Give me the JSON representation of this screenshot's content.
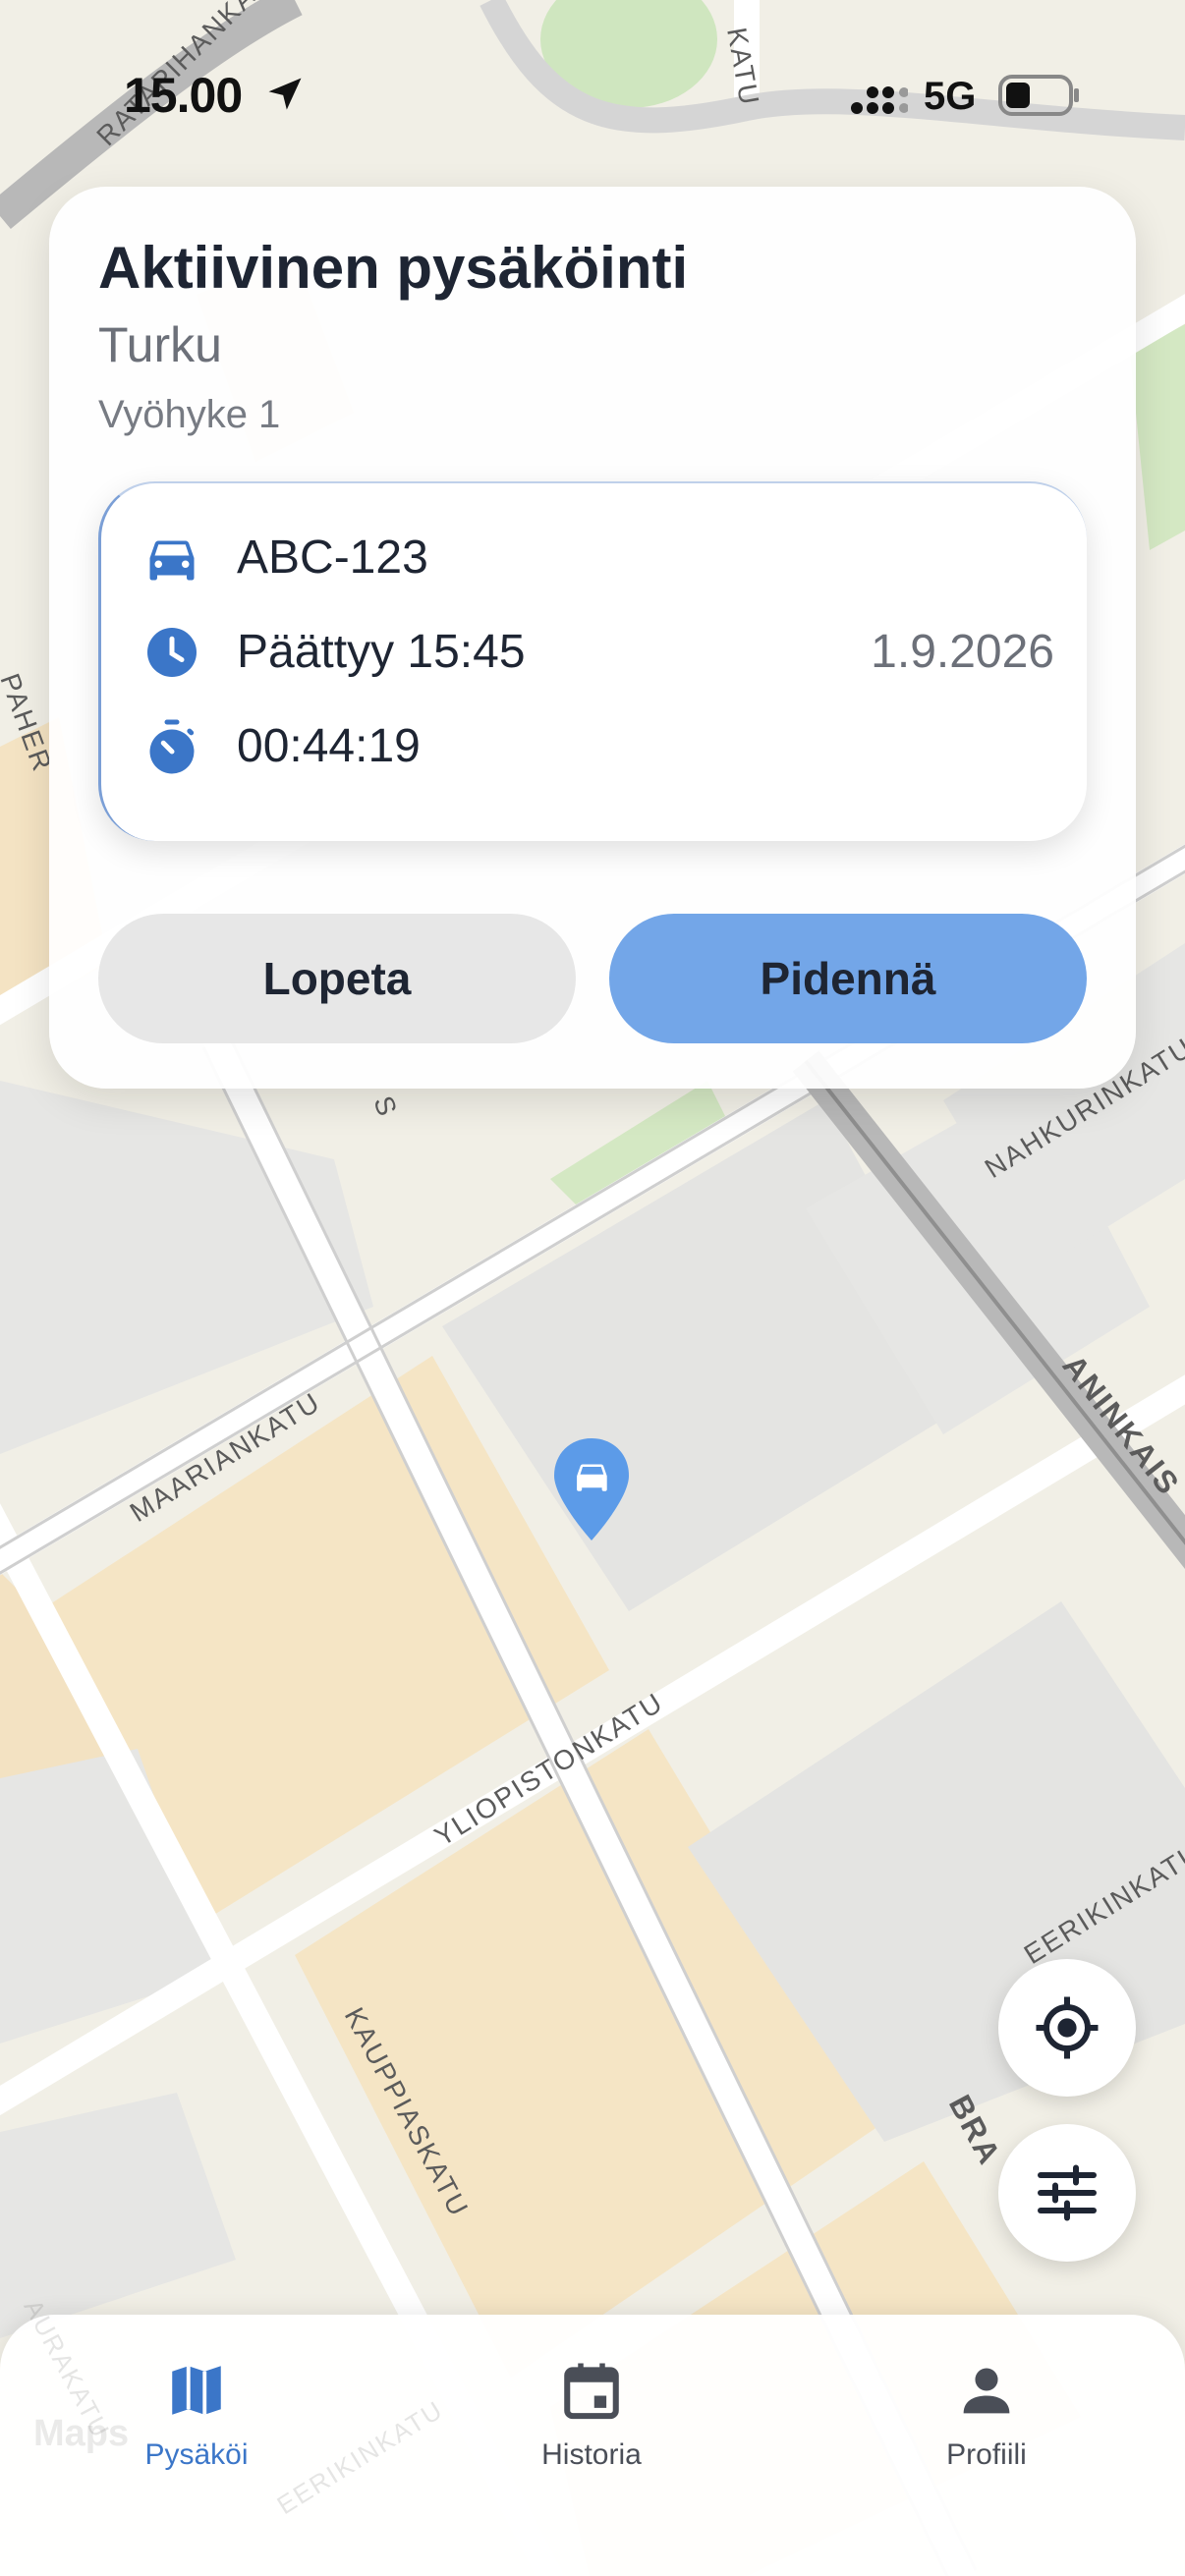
{
  "status_bar": {
    "time": "15.00",
    "network": "5G"
  },
  "map": {
    "streets": [
      "RATAPIHANKATU",
      "KATU",
      "PAHER",
      "NAHKURINKATU",
      "ANINKAIS",
      "MAARIANKATU",
      "YLIOPISTONKATU",
      "EERIKINKATU",
      "KAUPPIASKATU",
      "BRA",
      "AURAKATU",
      "EERIKINKATU"
    ],
    "street_extra": "S",
    "attribution": "Maps"
  },
  "active_parking": {
    "title": "Aktiivinen pysäköinti",
    "city": "Turku",
    "zone": "Vyöhyke 1",
    "plate": "ABC-123",
    "ends_label": "Päättyy 15:45",
    "date": "1.9.2026",
    "elapsed": "00:44:19",
    "stop_label": "Lopeta",
    "extend_label": "Pidennä"
  },
  "tabs": [
    {
      "label": "Pysäköi",
      "icon": "map-icon",
      "active": true
    },
    {
      "label": "Historia",
      "icon": "calendar-icon",
      "active": false
    },
    {
      "label": "Profiili",
      "icon": "person-icon",
      "active": false
    }
  ],
  "colors": {
    "accent": "#3b76c8",
    "extend_button": "#73a6e8",
    "stop_button": "#e7e7e7",
    "text": "#1e2533"
  }
}
